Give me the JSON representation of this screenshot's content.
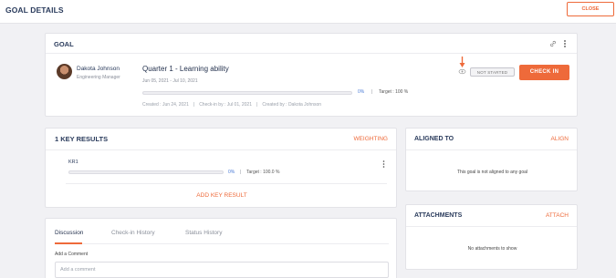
{
  "header": {
    "title": "GOAL DETAILS",
    "close_label": "CLOSE"
  },
  "goal": {
    "section_title": "GOAL",
    "owner_name": "Dakota Johnson",
    "owner_role": "Engineering Manager",
    "name": "Quarter 1 - Learning ability",
    "dates": "Jun 05, 2021 - Jul 10, 2021",
    "progress_percent": 0,
    "progress_label": "0%",
    "separator": "|",
    "target": "Target : 100 %",
    "created": "Created : Jun 24, 2021",
    "checkin_by": "Check-in by : Jul 01, 2021",
    "created_by": "Created by : Dakota Johnson",
    "status": "NOT STARTED",
    "checkin_label": "CHECK IN"
  },
  "key_results": {
    "title": "1  KEY RESULTS",
    "weighting_label": "WEIGHTING",
    "items": [
      {
        "name": "KR1",
        "progress_percent": 0,
        "progress_label": "0%",
        "separator": "|",
        "target": "Target : 100.0 %"
      }
    ],
    "add_label": "ADD KEY RESULT"
  },
  "aligned": {
    "title": "ALIGNED TO",
    "action_label": "ALIGN",
    "empty_text": "This goal is not aligned to any goal"
  },
  "attachments": {
    "title": "ATTACHMENTS",
    "action_label": "ATTACH",
    "empty_text": "No attachments to show"
  },
  "discussion": {
    "tabs": [
      {
        "label": "Discussion"
      },
      {
        "label": "Check-in History"
      },
      {
        "label": "Status History"
      }
    ],
    "add_comment_label": "Add a Comment",
    "comment_placeholder": "Add a comment"
  },
  "colors": {
    "accent": "#ee6a3a",
    "heading": "#2a3b5c",
    "progress_text": "#4a7bd6"
  }
}
